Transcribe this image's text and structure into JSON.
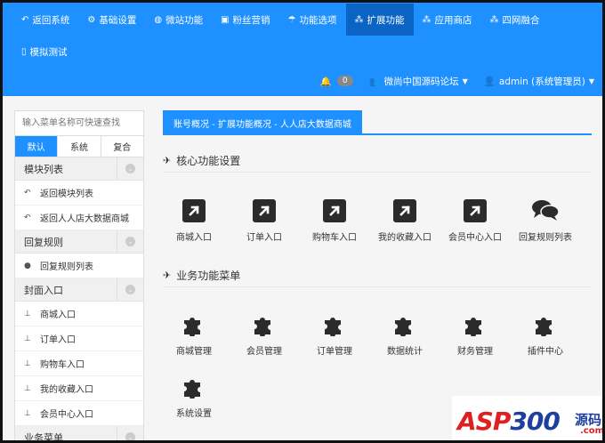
{
  "nav": [
    {
      "label": "返回系统",
      "icon": "reply-icon",
      "active": false
    },
    {
      "label": "基础设置",
      "icon": "gear-icon",
      "active": false
    },
    {
      "label": "微站功能",
      "icon": "globe-icon",
      "active": false
    },
    {
      "label": "粉丝营销",
      "icon": "gift-icon",
      "active": false
    },
    {
      "label": "功能选项",
      "icon": "umbrella-icon",
      "active": false
    },
    {
      "label": "扩展功能",
      "icon": "cubes-icon",
      "active": true
    },
    {
      "label": "应用商店",
      "icon": "cubes-icon",
      "active": false
    },
    {
      "label": "四网融合",
      "icon": "cubes-icon",
      "active": false
    }
  ],
  "nav2": [
    {
      "label": "模拟测试",
      "icon": "mobile-icon"
    }
  ],
  "header_right": {
    "notification_count": "0",
    "forum_label": "微尚中国源码论坛",
    "user_label": "admin (系统管理员)"
  },
  "sidebar": {
    "search_placeholder": "输入菜单名称可快速查找",
    "tabs": [
      "默认",
      "系统",
      "复合"
    ],
    "sections": [
      {
        "title": "模块列表",
        "items": [
          {
            "label": "返回模块列表",
            "icon": "reply-icon"
          },
          {
            "label": "返回人人店大数据商城",
            "icon": "reply-icon"
          }
        ]
      },
      {
        "title": "回复规则",
        "items": [
          {
            "label": "回复规则列表",
            "icon": "comments-icon"
          }
        ]
      },
      {
        "title": "封面入口",
        "items": [
          {
            "label": "商城入口",
            "icon": "sitemap-icon"
          },
          {
            "label": "订单入口",
            "icon": "sitemap-icon"
          },
          {
            "label": "购物车入口",
            "icon": "sitemap-icon"
          },
          {
            "label": "我的收藏入口",
            "icon": "sitemap-icon"
          },
          {
            "label": "会员中心入口",
            "icon": "sitemap-icon"
          }
        ]
      },
      {
        "title": "业务菜单",
        "items": []
      }
    ]
  },
  "breadcrumb": "账号概况 - 扩展功能概况 - 人人店大数据商城",
  "core": {
    "title": "核心功能设置",
    "tiles": [
      {
        "label": "商城入口",
        "icon": "external-link-icon"
      },
      {
        "label": "订单入口",
        "icon": "external-link-icon"
      },
      {
        "label": "购物车入口",
        "icon": "external-link-icon"
      },
      {
        "label": "我的收藏入口",
        "icon": "external-link-icon"
      },
      {
        "label": "会员中心入口",
        "icon": "external-link-icon"
      },
      {
        "label": "回复规则列表",
        "icon": "comments-icon"
      }
    ]
  },
  "business": {
    "title": "业务功能菜单",
    "tiles": [
      {
        "label": "商城管理",
        "icon": "puzzle-icon"
      },
      {
        "label": "会员管理",
        "icon": "puzzle-icon"
      },
      {
        "label": "订单管理",
        "icon": "puzzle-icon"
      },
      {
        "label": "数据统计",
        "icon": "puzzle-icon"
      },
      {
        "label": "财务管理",
        "icon": "puzzle-icon"
      },
      {
        "label": "插件中心",
        "icon": "puzzle-icon"
      },
      {
        "label": "系统设置",
        "icon": "puzzle-icon"
      }
    ]
  },
  "watermark": {
    "brand": "ASP",
    "digits": "300",
    "code": "源码",
    "domain": ".com"
  },
  "colors": {
    "primary": "#1e90ff",
    "active_nav": "#0b64c4",
    "icon_dark": "#2b2b2b"
  }
}
